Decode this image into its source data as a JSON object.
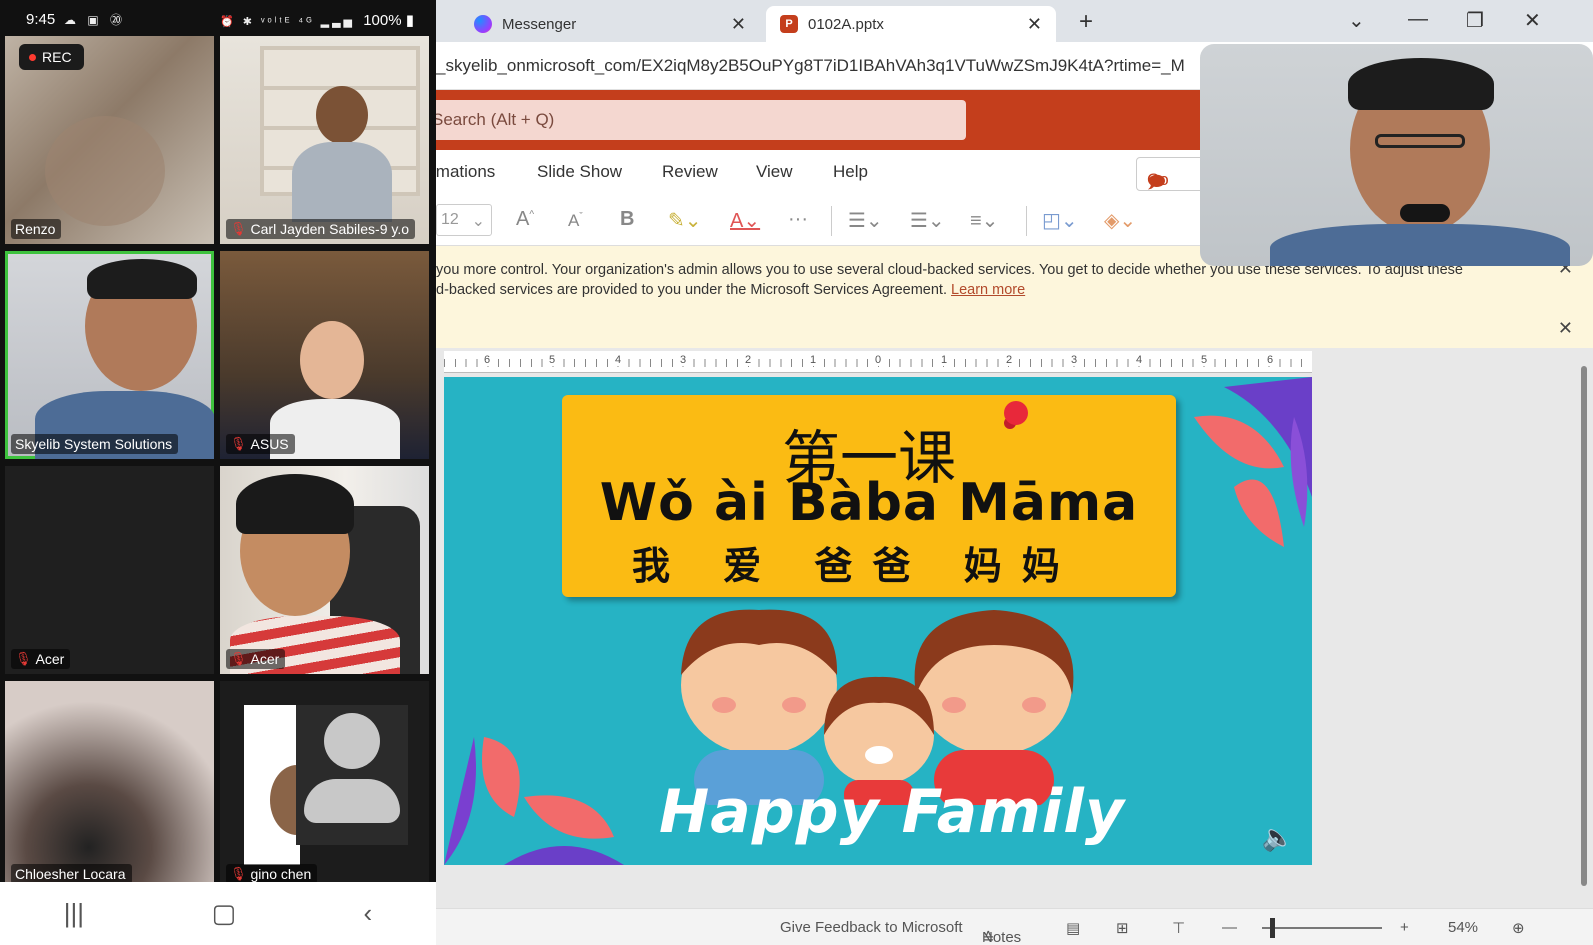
{
  "phone_status": {
    "time": "9:45",
    "left_icons": "☁ ▣ ⑳",
    "right_icons": "⏰ ✱ ᵛᵒˡᵗᴱ ⁴ᴳ ▂▃▅",
    "battery": "100%"
  },
  "meeting": {
    "rec_label": "REC",
    "participants": [
      {
        "name": "Renzo",
        "muted": false
      },
      {
        "name": "Carl Jayden Sabiles-9 y.o",
        "muted": true
      },
      {
        "name": "Skyelib System Solutions",
        "muted": false,
        "active": true
      },
      {
        "name": "ASUS",
        "muted": true
      },
      {
        "name": "Acer",
        "muted": true
      },
      {
        "name": "Acer",
        "muted": true
      },
      {
        "name": "Chloesher Locara",
        "muted": false
      },
      {
        "name": "gino chen",
        "muted": true
      }
    ]
  },
  "android_nav": {
    "recents": "|||",
    "home": "▢",
    "back": "‹"
  },
  "browser": {
    "tabs": [
      {
        "title": "Messenger"
      },
      {
        "title": "0102A.pptx"
      }
    ],
    "new_tab": "+",
    "url": "_skyelib_onmicrosoft_com/EX2iqM8y2B5OuPYg8T7iD1IBAhVAh3q1VTuWwZSmJ9K4tA?rtime=_M"
  },
  "ppt": {
    "search_placeholder": "Search (Alt + Q)",
    "ribbon_tabs": [
      "imations",
      "Slide Show",
      "Review",
      "View",
      "Help"
    ],
    "comments_label": "Co",
    "font_size": "12",
    "banner": {
      "line1": "you more control. Your organization's admin allows you to use several cloud-backed services. You get to decide whether you use these services. To adjust these",
      "line2": "d-backed services are provided to you under the Microsoft Services Agreement.",
      "link": "Learn more"
    },
    "ruler_numbers": [
      "6",
      "5",
      "4",
      "3",
      "2",
      "1",
      "0",
      "1",
      "2",
      "3",
      "4",
      "5",
      "6"
    ],
    "slide": {
      "lesson": "第一课",
      "pinyin": "Wǒ ài Bàba Māma",
      "hanzi": "我 爱 爸爸  妈妈",
      "footer": "Happy Family"
    },
    "status": {
      "feedback": "Give Feedback to Microsoft",
      "notes": "Notes",
      "zoom": "54%"
    }
  },
  "colors": {
    "ppt_brand": "#c43e1c",
    "slide_bg": "#26b3c4",
    "title_card": "#fbbb13",
    "active_speaker": "#3ec23e",
    "rec_dot": "#ff3b30"
  }
}
